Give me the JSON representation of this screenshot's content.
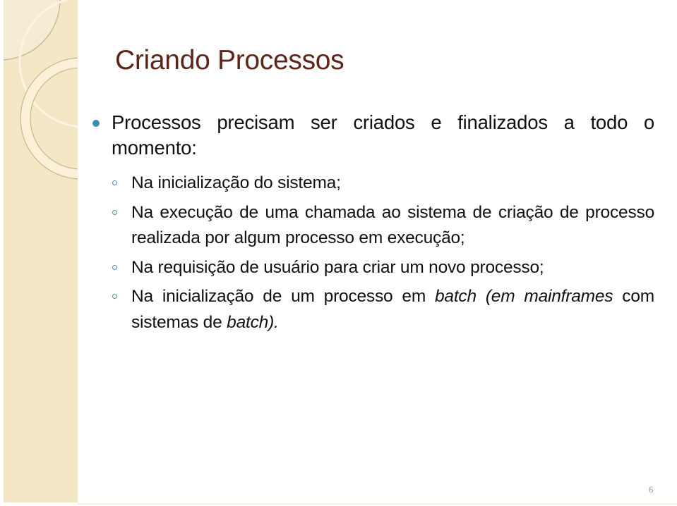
{
  "slide": {
    "title": "Criando Processos",
    "page_number": "6",
    "accent_color": "#3b8db5",
    "title_color": "#5b2519",
    "band_color": "#f3e4c1"
  },
  "bullets": [
    {
      "text": "Processos precisam ser criados e finalizados a todo o momento:",
      "icon": "filled-circle-bullet",
      "sub_items": [
        {
          "icon": "hollow-circle-bullet",
          "segments": [
            {
              "text": "Na inicialização do sistema;",
              "italic": false
            }
          ]
        },
        {
          "icon": "hollow-circle-bullet",
          "segments": [
            {
              "text": "Na execução de uma chamada ao sistema de criação de processo realizada por algum processo em execução;",
              "italic": false
            }
          ]
        },
        {
          "icon": "hollow-circle-bullet",
          "segments": [
            {
              "text": "Na requisição de usuário para criar um novo processo;",
              "italic": false
            }
          ]
        },
        {
          "icon": "hollow-circle-bullet",
          "segments": [
            {
              "text": "Na inicialização de um processo em ",
              "italic": false
            },
            {
              "text": "batch",
              "italic": true
            },
            {
              "text": " ",
              "italic": false
            },
            {
              "text": "(em mainframes",
              "italic": true
            },
            {
              "text": " com sistemas de ",
              "italic": false
            },
            {
              "text": "batch).",
              "italic": true
            }
          ]
        }
      ]
    }
  ]
}
